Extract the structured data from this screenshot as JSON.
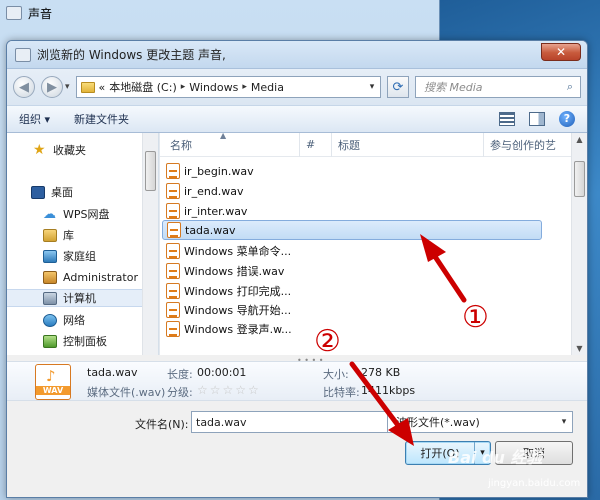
{
  "parent_window": {
    "title": "声音"
  },
  "dialog": {
    "title": "浏览新的 Windows 更改主题 声音,",
    "close_label": "✕"
  },
  "address": {
    "prefix": "«",
    "crumbs": [
      "本地磁盘 (C:)",
      "Windows",
      "Media"
    ],
    "search_placeholder": "搜索 Media"
  },
  "toolbar": {
    "organize": "组织 ▾",
    "new_folder": "新建文件夹"
  },
  "nav": {
    "items": [
      {
        "label": "收藏夹",
        "icon": "star-icon"
      },
      {
        "label": "桌面",
        "icon": "desktop-icon"
      },
      {
        "label": "WPS网盘",
        "icon": "cloud-icon"
      },
      {
        "label": "库",
        "icon": "library-icon"
      },
      {
        "label": "家庭组",
        "icon": "homegroup-icon"
      },
      {
        "label": "Administrator",
        "icon": "user-icon"
      },
      {
        "label": "计算机",
        "icon": "computer-icon"
      },
      {
        "label": "网络",
        "icon": "network-icon"
      },
      {
        "label": "控制面板",
        "icon": "control-panel-icon"
      }
    ]
  },
  "columns": {
    "name": "名称",
    "num": "#",
    "title": "标题",
    "contrib": "参与创作的艺"
  },
  "files": [
    "ir_begin.wav",
    "ir_end.wav",
    "ir_inter.wav",
    "tada.wav",
    "Windows 菜单命令...",
    "Windows 措误.wav",
    "Windows 打印完成...",
    "Windows 导航开始...",
    "Windows 登录声.w..."
  ],
  "selected_file": "tada.wav",
  "details": {
    "icon_label": "WAV",
    "name": "tada.wav",
    "type": "媒体文件(.wav)",
    "length_label": "长度:",
    "length_value": "00:00:01",
    "rating_label": "分级:",
    "rating_stars": "☆☆☆☆☆",
    "size_label": "大小:",
    "size_value": "278 KB",
    "bitrate_label": "比特率:",
    "bitrate_value": "1411kbps"
  },
  "filename": {
    "label": "文件名(N):",
    "value": "tada.wav"
  },
  "filetype": {
    "value": "波形文件(*.wav)"
  },
  "buttons": {
    "open": "打开(O)",
    "cancel": "取消"
  },
  "annotations": {
    "one": "①",
    "two": "②"
  },
  "watermark": {
    "brand": "Bai du 经验",
    "url": "jingyan.baidu.com"
  },
  "colors": {
    "arrow": "#cc0000",
    "selection": "#c2dcf5",
    "title_bar": "#c3d8ee"
  }
}
